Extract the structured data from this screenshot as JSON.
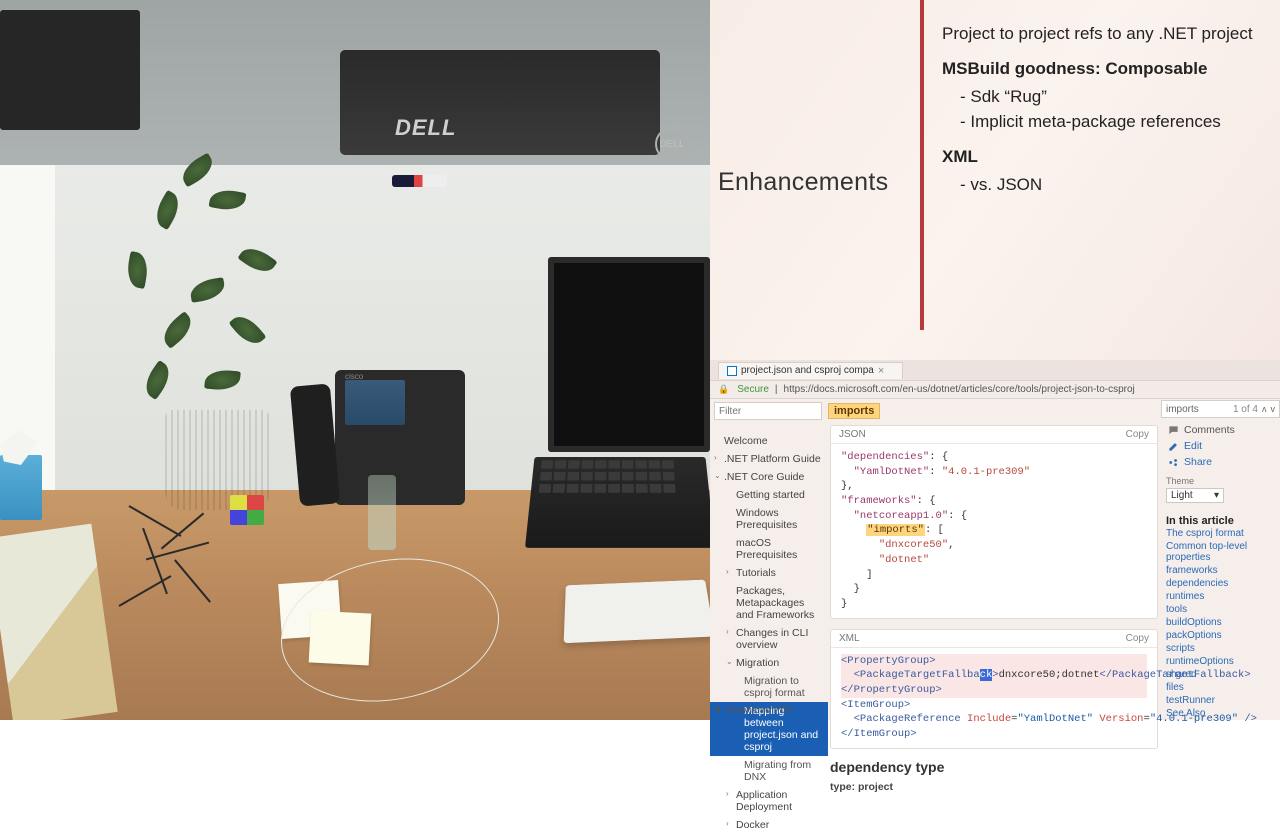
{
  "left_context": {
    "monitor_brand": "DELL",
    "phone_brand": "cisco"
  },
  "slide": {
    "side_heading": "Enhancements",
    "line1": "Project to project refs to any .NET project",
    "line2": "MSBuild goodness: Composable",
    "bullet2a": "Sdk “Rug”",
    "bullet2b": "Implicit meta-package references",
    "line3": "XML",
    "bullet3a": "vs. JSON"
  },
  "browser": {
    "tab_title": "project.json and csproj compa",
    "secure_label": "Secure",
    "url": "https://docs.microsoft.com/en-us/dotnet/articles/core/tools/project-json-to-csproj",
    "filter_placeholder": "Filter",
    "highlight_term": "imports",
    "find_term": "imports",
    "find_count": "1 of 4",
    "nav": {
      "welcome": "Welcome",
      "platform_guide": ".NET Platform Guide",
      "core_guide": ".NET Core Guide",
      "getting_started": "Getting started",
      "win_prereq": "Windows Prerequisites",
      "mac_prereq": "macOS Prerequisites",
      "tutorials": "Tutorials",
      "packages": "Packages, Metapackages and Frameworks",
      "cli_changes": "Changes in CLI overview",
      "migration": "Migration",
      "mig_format": "Migration to csproj format",
      "mig_mapping": "Mapping between project.json and csproj",
      "mig_dnx": "Migrating from DNX",
      "app_deploy": "Application Deployment",
      "docker": "Docker"
    },
    "download_pdf": "Download PDF",
    "card_json_label": "JSON",
    "card_xml_label": "XML",
    "copy_label": "Copy",
    "json_code": {
      "l1a": "\"dependencies\"",
      "l1b": ": {",
      "l2a": "\"YamlDotNet\"",
      "l2b": ": ",
      "l2c": "\"4.0.1-pre309\"",
      "l3": "},",
      "l4a": "\"frameworks\"",
      "l4b": ": {",
      "l5a": "\"netcoreapp1.0\"",
      "l5b": ": {",
      "l6a": "\"imports\"",
      "l6b": ": [",
      "l7": "\"dnxcore50\"",
      "l7b": ",",
      "l8": "\"dotnet\"",
      "l9": "]",
      "l10": "}",
      "l11": "}"
    },
    "xml_code": {
      "l1o": "<PropertyGroup>",
      "l2o": "<PackageTargetFallba",
      "l2sel": "ck",
      "l2o2": ">",
      "l2t": "dnxcore50;dotnet",
      "l2c": "</PackageTargetFallback>",
      "l3": "</PropertyGroup>",
      "l4": "<ItemGroup>",
      "l5a": "<PackageReference ",
      "l5b": "Include",
      "l5c": "=",
      "l5d": "\"YamlDotNet\"",
      "l5e": " Version",
      "l5f": "=",
      "l5g": "\"4.0.1-pre309\"",
      "l5h": " />",
      "l6": "</ItemGroup>"
    },
    "h_dep": "dependency type",
    "sub_type": "type: project",
    "right": {
      "edit": "Edit",
      "share": "Share",
      "comments": "Comments",
      "theme_label": "Theme",
      "theme_value": "Light",
      "in_this": "In this article",
      "toc": [
        "The csproj format",
        "Common top-level properties",
        "frameworks",
        "dependencies",
        "runtimes",
        "tools",
        "buildOptions",
        "packOptions",
        "scripts",
        "runtimeOptions",
        "shared",
        "files",
        "testRunner",
        "See Also"
      ]
    }
  }
}
